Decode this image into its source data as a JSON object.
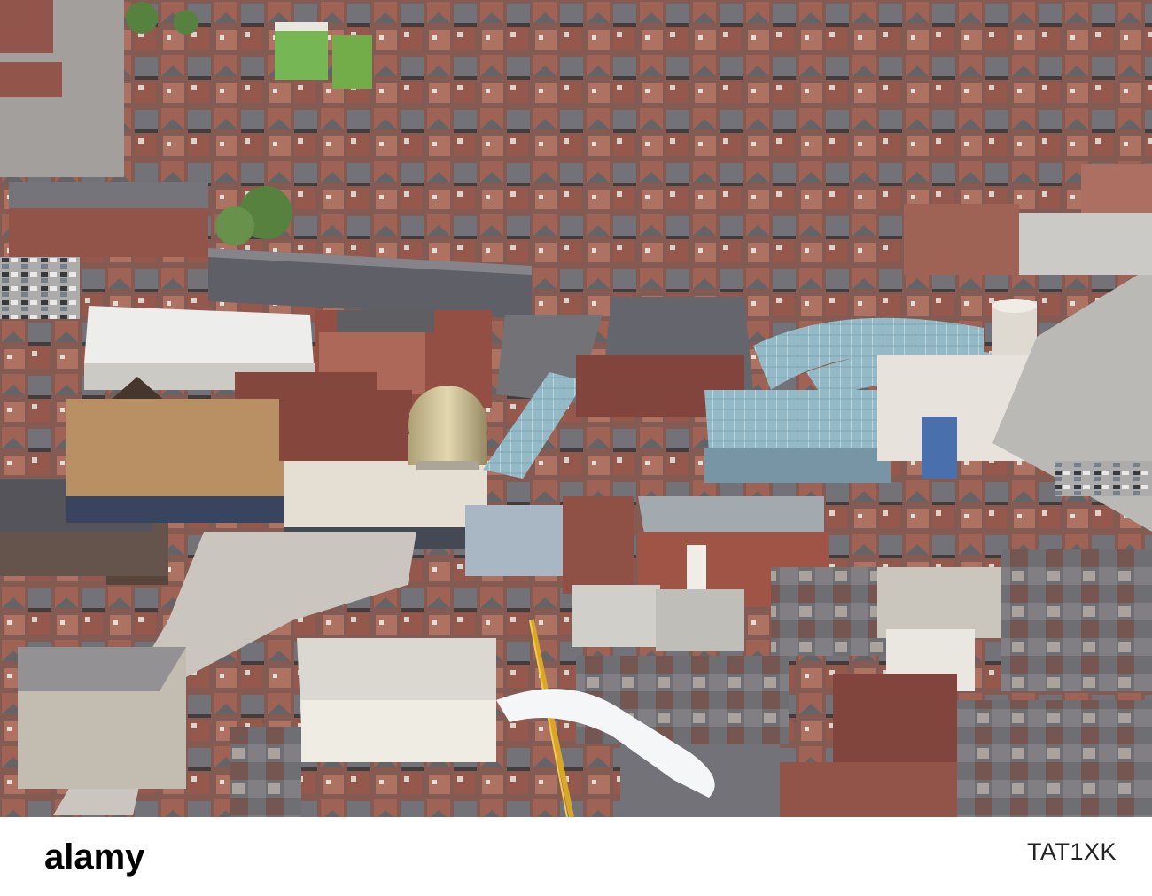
{
  "photo": {
    "subject": "aerial-view-town-centre"
  },
  "watermark": {
    "brand": "alamy",
    "image_id": "TAT1XK"
  },
  "colors": {
    "brick": "#8b4c40",
    "roof_slate": "#5a5a62",
    "glass_roof": "#8fb6c4",
    "stone": "#d8cfc0",
    "dome": "#c9b98a",
    "footer_bg": "#ffffff",
    "logo_text": "#000000"
  }
}
